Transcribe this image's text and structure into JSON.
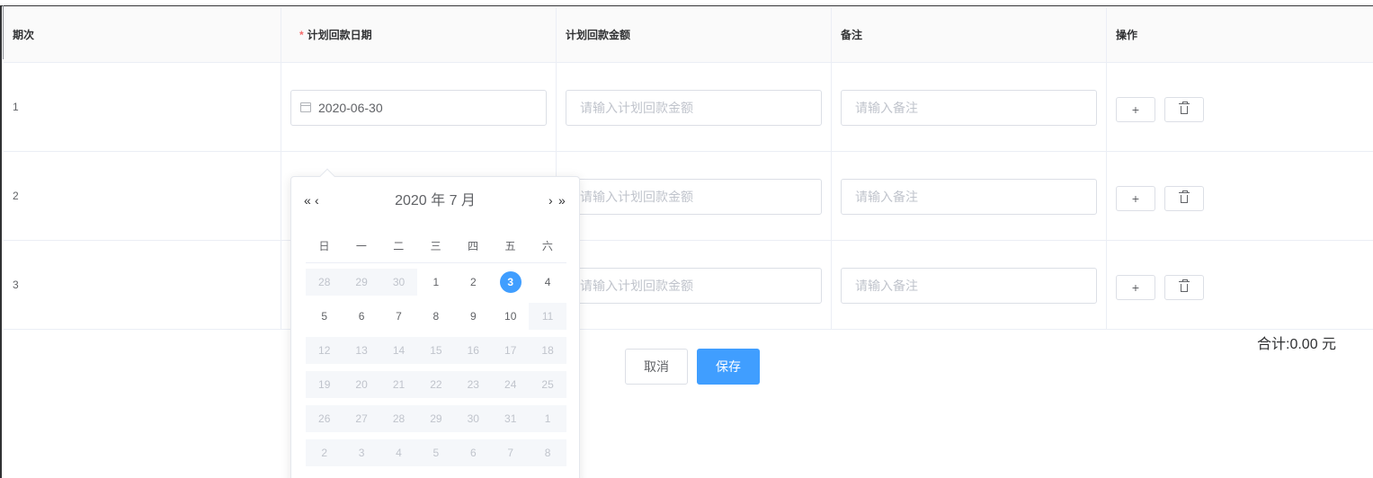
{
  "table": {
    "headers": {
      "period": "期次",
      "required_mark": "*",
      "date": "计划回款日期",
      "amount": "计划回款金额",
      "remark": "备注",
      "actions": "操作"
    },
    "rows": [
      {
        "index": "1",
        "date_value": "2020-06-30",
        "amount_placeholder": "请输入计划回款金额",
        "remark_placeholder": "请输入备注"
      },
      {
        "index": "2",
        "amount_placeholder": "请输入计划回款金额",
        "remark_placeholder": "请输入备注"
      },
      {
        "index": "3",
        "amount_placeholder": "请输入计划回款金额",
        "remark_placeholder": "请输入备注"
      }
    ],
    "add_glyph": "+"
  },
  "footer": {
    "total": "合计:0.00 元",
    "cancel_label": "取消",
    "save_label": "保存"
  },
  "date_picker": {
    "prev_year": "«",
    "prev_month": "‹",
    "next_month": "›",
    "next_year": "»",
    "title": "2020 年  7 月",
    "weekdays": [
      "日",
      "一",
      "二",
      "三",
      "四",
      "五",
      "六"
    ],
    "today": "3",
    "weeks": [
      [
        {
          "d": "28",
          "s": "other-disabled"
        },
        {
          "d": "29",
          "s": "other-disabled"
        },
        {
          "d": "30",
          "s": "other-disabled"
        },
        {
          "d": "1",
          "s": "normal"
        },
        {
          "d": "2",
          "s": "normal"
        },
        {
          "d": "3",
          "s": "today"
        },
        {
          "d": "4",
          "s": "normal"
        }
      ],
      [
        {
          "d": "5",
          "s": "normal"
        },
        {
          "d": "6",
          "s": "normal"
        },
        {
          "d": "7",
          "s": "normal"
        },
        {
          "d": "8",
          "s": "normal"
        },
        {
          "d": "9",
          "s": "normal"
        },
        {
          "d": "10",
          "s": "normal"
        },
        {
          "d": "11",
          "s": "disabled"
        }
      ],
      [
        {
          "d": "12",
          "s": "disabled"
        },
        {
          "d": "13",
          "s": "disabled"
        },
        {
          "d": "14",
          "s": "disabled"
        },
        {
          "d": "15",
          "s": "disabled"
        },
        {
          "d": "16",
          "s": "disabled"
        },
        {
          "d": "17",
          "s": "disabled"
        },
        {
          "d": "18",
          "s": "disabled"
        }
      ],
      [
        {
          "d": "19",
          "s": "disabled"
        },
        {
          "d": "20",
          "s": "disabled"
        },
        {
          "d": "21",
          "s": "disabled"
        },
        {
          "d": "22",
          "s": "disabled"
        },
        {
          "d": "23",
          "s": "disabled"
        },
        {
          "d": "24",
          "s": "disabled"
        },
        {
          "d": "25",
          "s": "disabled"
        }
      ],
      [
        {
          "d": "26",
          "s": "disabled"
        },
        {
          "d": "27",
          "s": "disabled"
        },
        {
          "d": "28",
          "s": "disabled"
        },
        {
          "d": "29",
          "s": "disabled"
        },
        {
          "d": "30",
          "s": "disabled"
        },
        {
          "d": "31",
          "s": "disabled"
        },
        {
          "d": "1",
          "s": "disabled"
        }
      ],
      [
        {
          "d": "2",
          "s": "disabled"
        },
        {
          "d": "3",
          "s": "disabled"
        },
        {
          "d": "4",
          "s": "disabled"
        },
        {
          "d": "5",
          "s": "disabled"
        },
        {
          "d": "6",
          "s": "disabled"
        },
        {
          "d": "7",
          "s": "disabled"
        },
        {
          "d": "8",
          "s": "disabled"
        }
      ]
    ]
  },
  "colors": {
    "primary": "#409eff",
    "required": "#f56c6c",
    "disabled_bg": "#f5f7fa"
  }
}
